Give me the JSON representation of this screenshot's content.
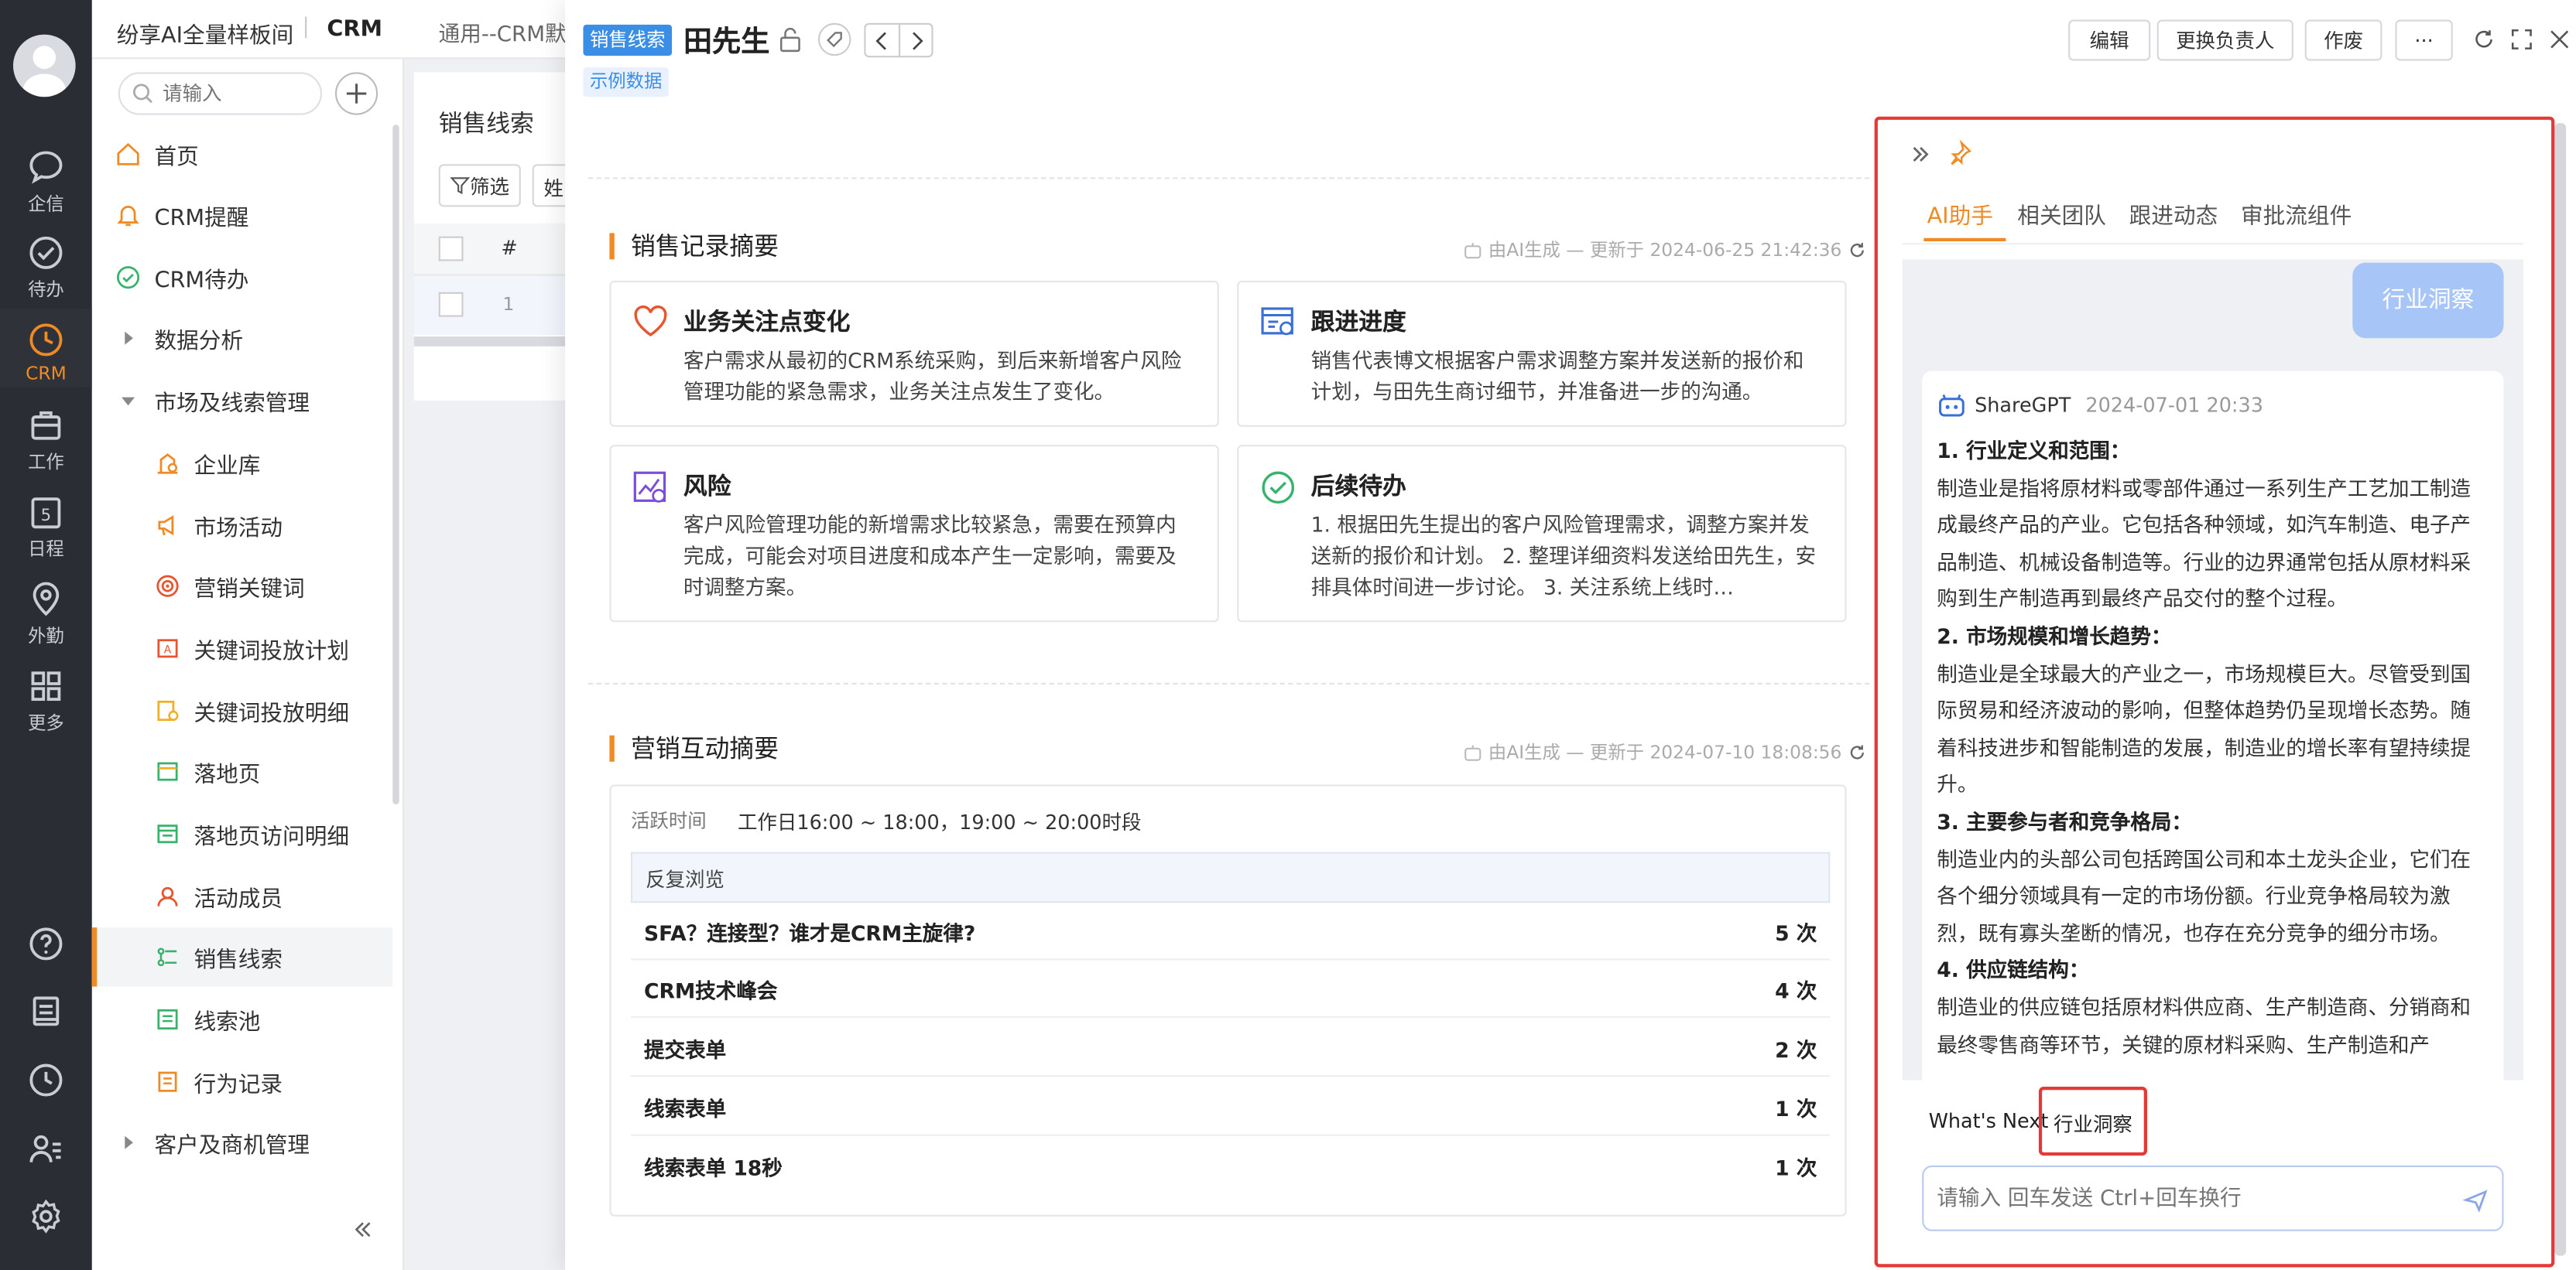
{
  "rail": {
    "items": [
      {
        "label": "企信",
        "icon": "chat-bubble-icon"
      },
      {
        "label": "待办",
        "icon": "check-circle-icon"
      },
      {
        "label": "CRM",
        "icon": "crm-clock-icon"
      },
      {
        "label": "工作",
        "icon": "briefcase-icon"
      },
      {
        "label": "日程",
        "icon": "calendar-icon",
        "badge": "5"
      },
      {
        "label": "外勤",
        "icon": "location-pin-icon"
      },
      {
        "label": "更多",
        "icon": "grid-icon"
      }
    ]
  },
  "nav": {
    "org_name": "纷享AI全量样板间",
    "app_name": "CRM",
    "search_placeholder": "请输入",
    "items": [
      {
        "label": "首页",
        "icon": "home-icon"
      },
      {
        "label": "CRM提醒",
        "icon": "bell-icon"
      },
      {
        "label": "CRM待办",
        "icon": "todo-check-icon"
      },
      {
        "label": "数据分析",
        "icon": "caret-right-icon"
      },
      {
        "label": "市场及线索管理",
        "icon": "caret-down-icon"
      },
      {
        "label": "企业库",
        "icon": "building-icon"
      },
      {
        "label": "市场活动",
        "icon": "megaphone-icon"
      },
      {
        "label": "营销关键词",
        "icon": "target-icon"
      },
      {
        "label": "关键词投放计划",
        "icon": "ad-plan-icon"
      },
      {
        "label": "关键词投放明细",
        "icon": "ad-detail-icon"
      },
      {
        "label": "落地页",
        "icon": "landing-page-icon"
      },
      {
        "label": "落地页访问明细",
        "icon": "landing-visit-icon"
      },
      {
        "label": "活动成员",
        "icon": "member-icon"
      },
      {
        "label": "销售线索",
        "icon": "lead-icon"
      },
      {
        "label": "线索池",
        "icon": "pool-icon"
      },
      {
        "label": "行为记录",
        "icon": "record-icon"
      },
      {
        "label": "客户及商机管理",
        "icon": "caret-right-icon"
      }
    ]
  },
  "bg": {
    "breadcrumb": "通用--CRM默",
    "page_title": "销售线索",
    "filter_label": "筛选",
    "col_partial": "姓",
    "col_index": "#",
    "row_index": "1"
  },
  "detail": {
    "object_tag": "销售线索",
    "title": "田先生",
    "sample_tag": "示例数据",
    "buttons": [
      "编辑",
      "更换负责人",
      "作废",
      "···"
    ],
    "summary": {
      "title": "销售记录摘要",
      "note": "由AI生成 — 更新于 2024-06-25 21:42:36",
      "cards": [
        {
          "title": "业务关注点变化",
          "body": "客户需求从最初的CRM系统采购，到后来新增客户风险管理功能的紧急需求，业务关注点发生了变化。"
        },
        {
          "title": "跟进进度",
          "body": "销售代表博文根据客户需求调整方案并发送新的报价和计划，与田先生商讨细节，并准备进一步的沟通。"
        },
        {
          "title": "风险",
          "body": "客户风险管理功能的新增需求比较紧急，需要在预算内完成，可能会对项目进度和成本产生一定影响，需要及时调整方案。"
        },
        {
          "title": "后续待办",
          "body": "1. 根据田先生提出的客户风险管理需求，调整方案并发送新的报价和计划。 2. 整理详细资料发送给田先生，安排具体时间进一步讨论。 3. 关注系统上线时…"
        }
      ]
    },
    "marketing": {
      "title": "营销互动摘要",
      "note": "由AI生成 — 更新于 2024-07-10 18:08:56",
      "active_label": "活跃时间",
      "active_value": "工作日16:00 ~ 18:00，19:00 ~ 20:00时段",
      "table_header": "反复浏览",
      "rows": [
        {
          "name": "SFA？连接型？谁才是CRM主旋律?",
          "count": "5 次"
        },
        {
          "name": "CRM技术峰会",
          "count": "4 次"
        },
        {
          "name": "提交表单",
          "count": "2 次"
        },
        {
          "name": "线索表单",
          "count": "1 次"
        },
        {
          "name": "线索表单 18秒",
          "count": "1 次"
        }
      ]
    }
  },
  "ai": {
    "tabs": [
      "AI助手",
      "相关团队",
      "跟进动态",
      "审批流组件"
    ],
    "user_msg": "行业洞察",
    "bot_name": "ShareGPT",
    "bot_time": "2024-07-01 20:33",
    "answer": [
      {
        "h": true,
        "text": "1. 行业定义和范围："
      },
      {
        "h": false,
        "text": "制造业是指将原材料或零部件通过一系列生产工艺加工制造成最终产品的产业。它包括各种领域，如汽车制造、电子产品制造、机械设备制造等。行业的边界通常包括从原材料采购到生产制造再到最终产品交付的整个过程。"
      },
      {
        "h": true,
        "text": "2. 市场规模和增长趋势："
      },
      {
        "h": false,
        "text": "制造业是全球最大的产业之一，市场规模巨大。尽管受到国际贸易和经济波动的影响，但整体趋势仍呈现增长态势。随着科技进步和智能制造的发展，制造业的增长率有望持续提升。"
      },
      {
        "h": true,
        "text": "3. 主要参与者和竞争格局："
      },
      {
        "h": false,
        "text": "制造业内的头部公司包括跨国公司和本土龙头企业，它们在各个细分领域具有一定的市场份额。行业竞争格局较为激烈，既有寡头垄断的情况，也存在充分竞争的细分市场。"
      },
      {
        "h": true,
        "text": "4. 供应链结构："
      },
      {
        "h": false,
        "text": "制造业的供应链包括原材料供应商、生产制造商、分销商和最终零售商等环节，关键的原材料采购、生产制造和产"
      }
    ],
    "quick_actions": [
      "What's Next",
      "行业洞察"
    ],
    "input_placeholder": "请输入 回车发送 Ctrl+回车换行",
    "colors": {
      "accent": "#f08a24",
      "bubble": "#a8c5f7",
      "highlight": "#e53935"
    }
  }
}
